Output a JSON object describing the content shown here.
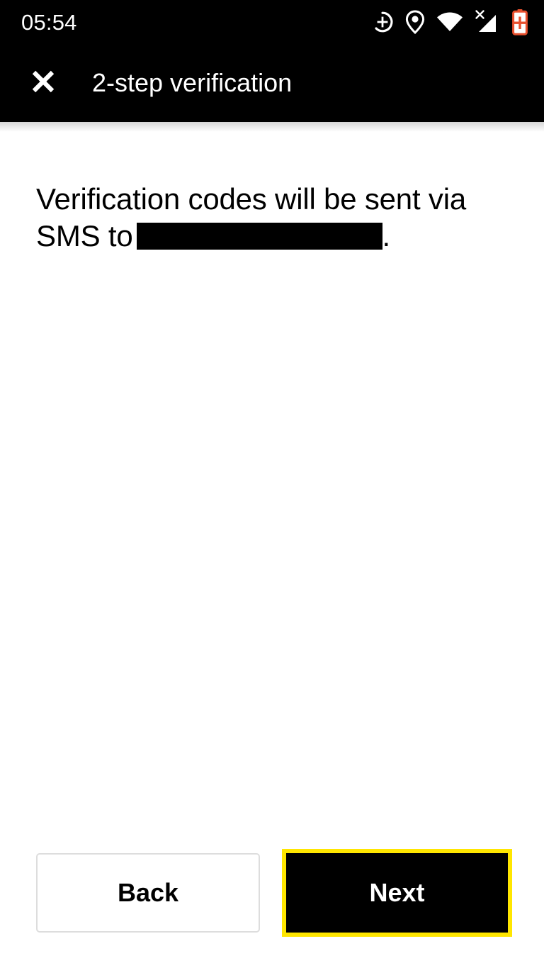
{
  "status_bar": {
    "clock": "05:54",
    "icons": [
      {
        "name": "magnification-accessibility-icon",
        "label": "accessibility magnifier"
      },
      {
        "name": "location-pin-icon",
        "label": "location"
      },
      {
        "name": "wifi-icon",
        "label": "wi-fi full signal"
      },
      {
        "name": "cellular-no-service-icon",
        "label": "no sim / no service"
      },
      {
        "name": "battery-warning-icon",
        "label": "battery",
        "color": "#E8502E"
      }
    ]
  },
  "app_bar": {
    "close_icon": "close-icon",
    "title": "2-step verification"
  },
  "main": {
    "message_before": "Verification codes will be sent via SMS to",
    "message_redacted": true,
    "message_after": "."
  },
  "footer": {
    "back_label": "Back",
    "next_label": "Next",
    "focused_button": "Next",
    "focus_ring_color": "#FFE600",
    "back_border_color": "#DDDDDD",
    "next_background": "#000000"
  }
}
